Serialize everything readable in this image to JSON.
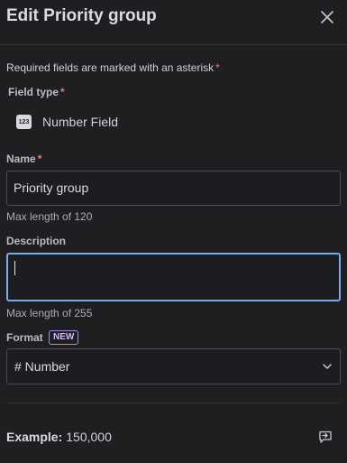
{
  "header": {
    "title": "Edit Priority group",
    "close_icon": "close-icon"
  },
  "form": {
    "required_note": "Required fields are marked with an asterisk",
    "required_marker": "*",
    "field_type": {
      "label": "Field type",
      "icon": "number-field-icon",
      "icon_text": "123",
      "value": "Number Field"
    },
    "name": {
      "label": "Name",
      "value": "Priority group",
      "hint": "Max length of 120"
    },
    "description": {
      "label": "Description",
      "value": "",
      "hint": "Max length of 255"
    },
    "format": {
      "label": "Format",
      "badge": "NEW",
      "value": "# Number"
    }
  },
  "footer": {
    "example_label": "Example:",
    "example_value": "150,000",
    "icon": "preview-icon"
  },
  "colors": {
    "background": "#1f1f21",
    "required_star": "#f17a7a",
    "focus_border": "#7ca9e8",
    "badge": "#a98be8"
  }
}
